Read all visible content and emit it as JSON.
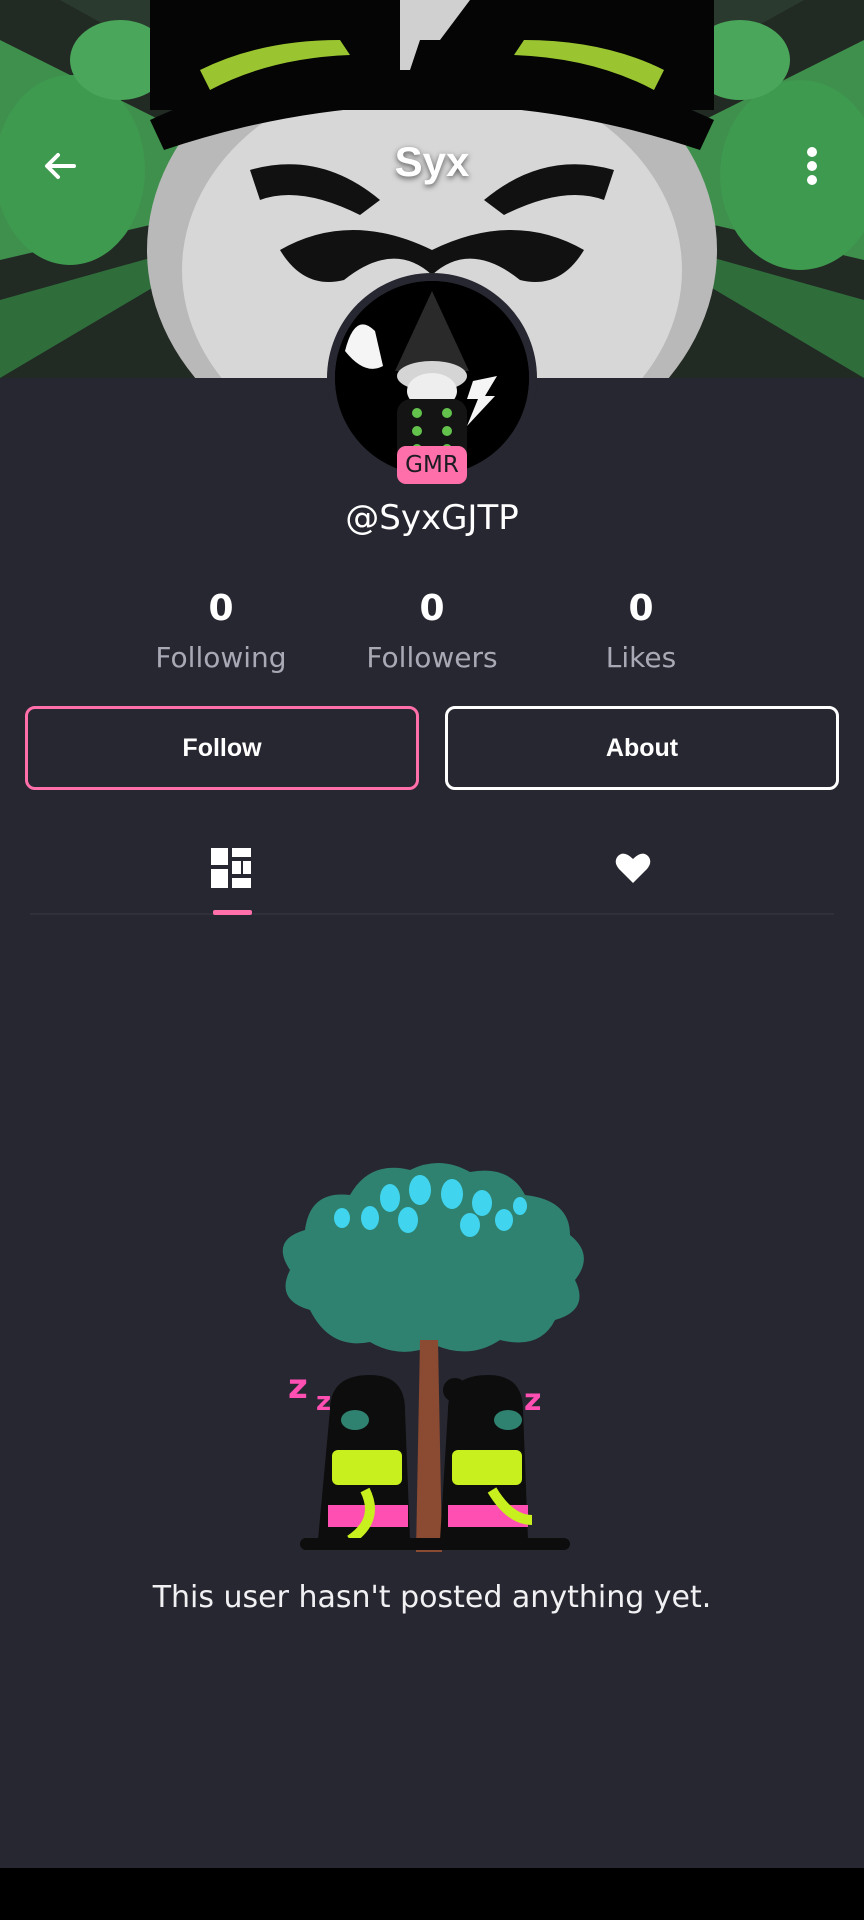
{
  "header": {
    "title": "Syx",
    "back_icon": "arrow-left-icon",
    "menu_icon": "more-vertical-icon"
  },
  "profile": {
    "badge": "GMR",
    "username": "@SyxGJTP"
  },
  "stats": [
    {
      "value": "0",
      "label": "Following"
    },
    {
      "value": "0",
      "label": "Followers"
    },
    {
      "value": "0",
      "label": "Likes"
    }
  ],
  "actions": {
    "follow_label": "Follow",
    "about_label": "About"
  },
  "tabs": [
    {
      "icon": "grid-icon",
      "selected": true
    },
    {
      "icon": "heart-icon",
      "selected": false
    }
  ],
  "empty_state": {
    "message": "This user hasn't posted anything yet."
  },
  "colors": {
    "accent": "#ff6fa9",
    "background": "#272731",
    "secondary_text": "#a9a9b5"
  }
}
